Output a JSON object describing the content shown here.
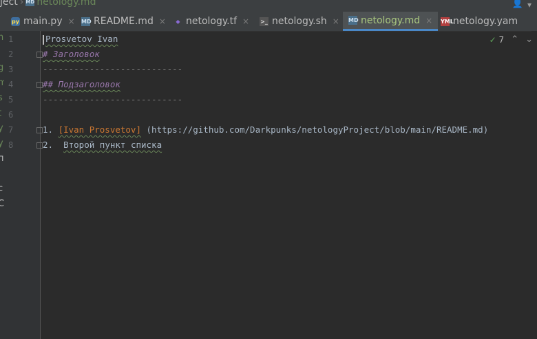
{
  "breadcrumb": {
    "project": "ject",
    "file": "netology.md"
  },
  "tabs": [
    {
      "label": "main.py",
      "icon": "python-file-icon",
      "active": false
    },
    {
      "label": "README.md",
      "icon": "markdown-file-icon",
      "active": false
    },
    {
      "label": "netology.tf",
      "icon": "terraform-file-icon",
      "active": false
    },
    {
      "label": "netology.sh",
      "icon": "shell-file-icon",
      "active": false
    },
    {
      "label": "netology.md",
      "icon": "markdown-file-icon",
      "active": true
    },
    {
      "label": "netology.yam",
      "icon": "yaml-file-icon",
      "active": false
    }
  ],
  "inspection": {
    "count": "7"
  },
  "line_numbers": [
    "1",
    "2",
    "3",
    "4",
    "5",
    "6",
    "7",
    "8"
  ],
  "editor": {
    "line1": "Prosvetov Ivan",
    "line2": "# Заголовок",
    "line3": "---------------------------",
    "line4": "## Подзаголовок",
    "line5": "---------------------------",
    "line7_num": "1. ",
    "line7_link": "[Ivan Prosvetov]",
    "line7_url": " (https://github.com/Darkpunks/netologyProject/blob/main/README.md)",
    "line8_num": "2.  ",
    "line8_text": "Второй пункт списка"
  },
  "left_strip_chars": [
    "h",
    "j",
    "g",
    "m",
    "s",
    "t",
    "y",
    "y",
    "п",
    "c",
    "C"
  ]
}
